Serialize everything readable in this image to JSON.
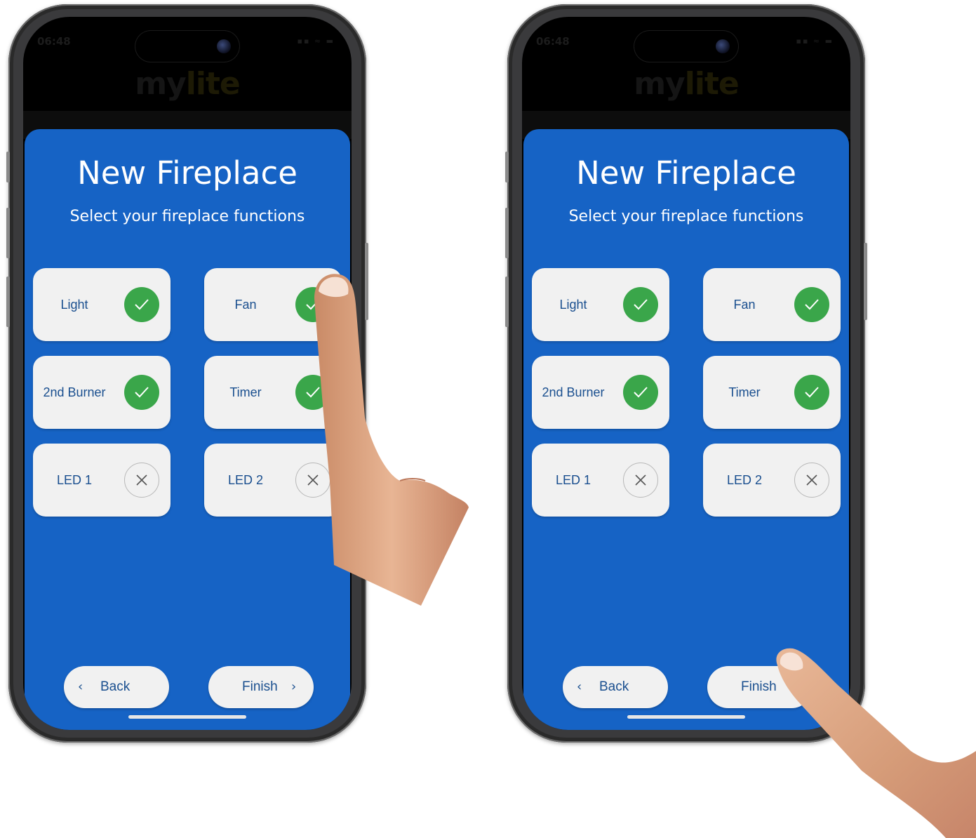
{
  "status": {
    "time": "06:48",
    "icons": "▪▪ ≈ ▬"
  },
  "app": {
    "logo_part1": "my",
    "logo_part2": "lite"
  },
  "screen": {
    "title": "New Fireplace",
    "subtitle": "Select your fireplace functions"
  },
  "functions": [
    {
      "label": "Light",
      "state": "selected"
    },
    {
      "label": "Fan",
      "state": "selected"
    },
    {
      "label": "2nd Burner",
      "state": "selected"
    },
    {
      "label": "Timer",
      "state": "selected"
    },
    {
      "label": "LED 1",
      "state": "unselected"
    },
    {
      "label": "LED 2",
      "state": "unselected"
    }
  ],
  "nav": {
    "back_label": "Back",
    "back_chevron": "‹",
    "finish_label": "Finish",
    "finish_chevron": "›"
  },
  "colors": {
    "sheet": "#1663c5",
    "check": "#3aa64a",
    "tile": "#f1f1f1",
    "text_blue": "#1a4f8f"
  }
}
